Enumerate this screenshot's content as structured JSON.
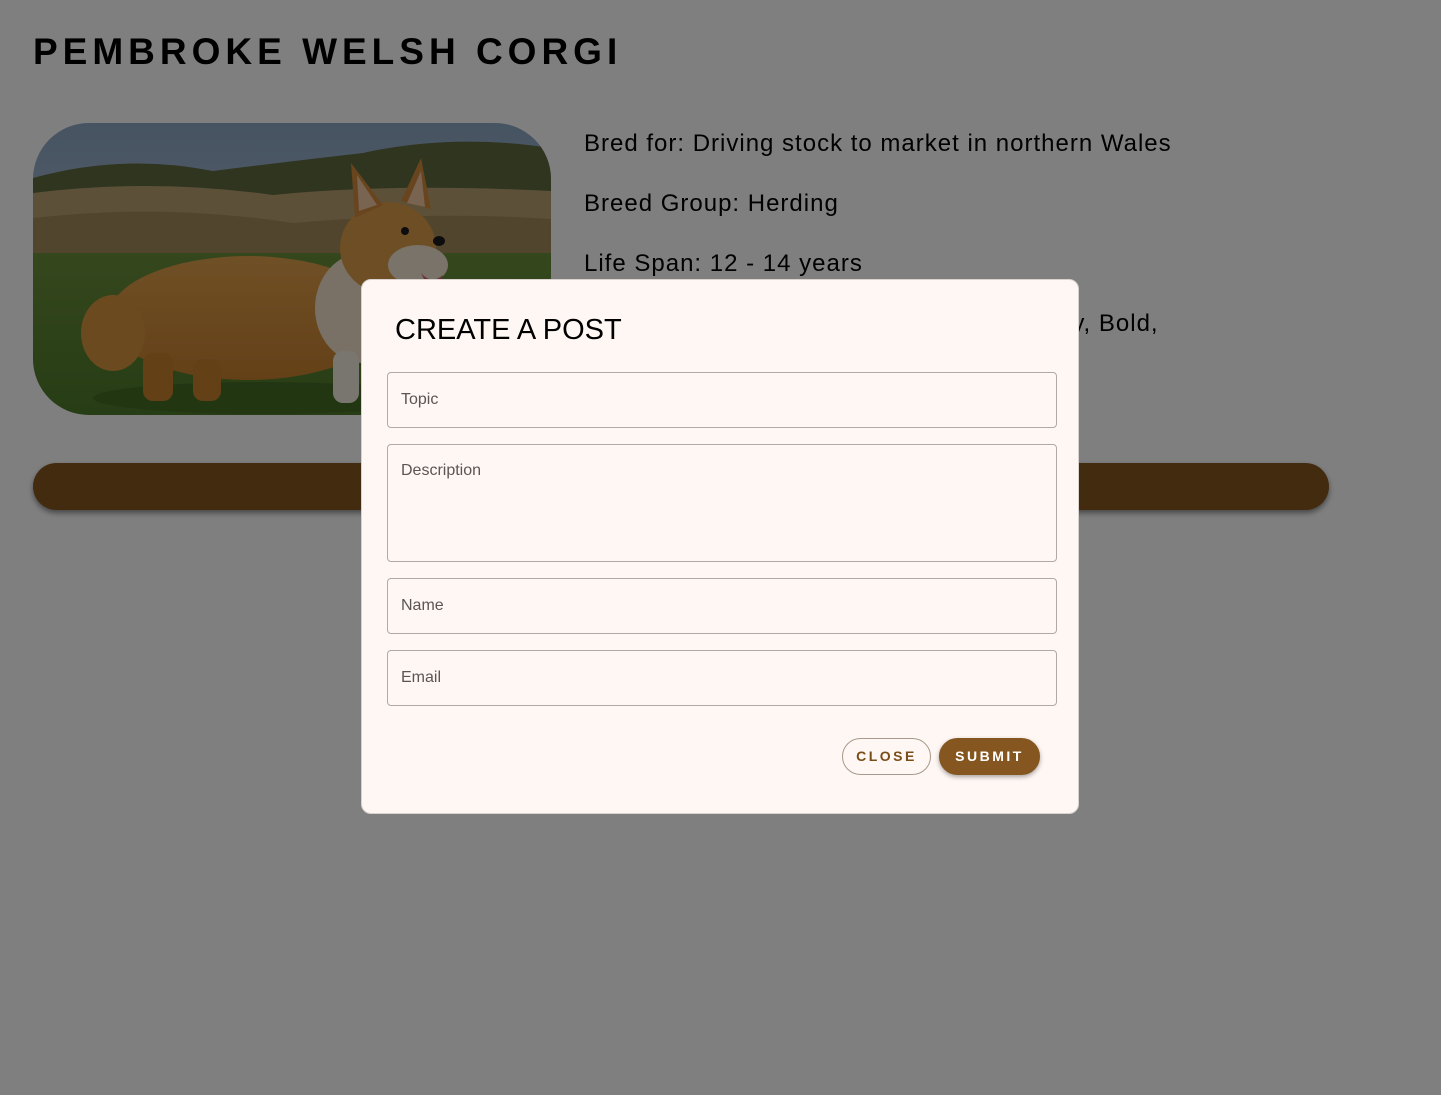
{
  "page": {
    "title": "PEMBROKE WELSH CORGI"
  },
  "breed_info": {
    "bred_for": "Bred for: Driving stock to market in northern Wales",
    "breed_group": "Breed Group: Herding",
    "life_span": "Life Span: 12 - 14 years",
    "temperament_visible": "ly, Bold,"
  },
  "photo": {
    "alt": "Pembroke Welsh Corgi standing on grass"
  },
  "modal": {
    "title": "CREATE A POST",
    "topic_placeholder": "Topic",
    "description_placeholder": "Description",
    "name_placeholder": "Name",
    "email_placeholder": "Email",
    "close_label": "CLOSE",
    "submit_label": "SUBMIT"
  },
  "colors": {
    "accent": "#85561f",
    "modal_bg": "#fff7f4",
    "backdrop": "rgba(0,0,0,0.5)"
  }
}
